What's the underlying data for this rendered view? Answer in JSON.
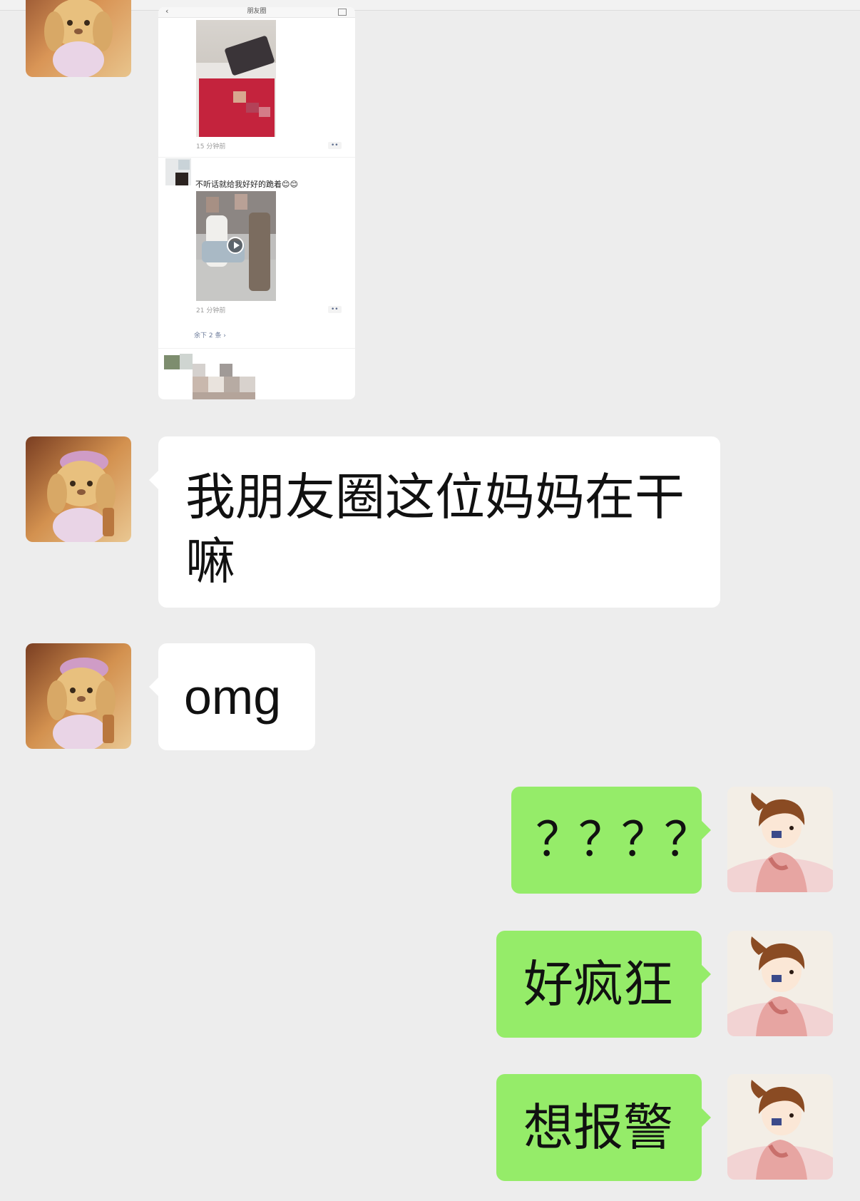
{
  "screenshot_card": {
    "header_title": "朋友圈",
    "back_glyph": "‹",
    "post1_time": "15 分钟前",
    "post2_caption": "不听话就给我好好的跪着😊😊",
    "post2_time": "21 分钟前",
    "more_link": "余下 2 条 ›",
    "dots": "••"
  },
  "messages": [
    {
      "side": "in",
      "text": "我朋友圈这位妈妈在干嘛"
    },
    {
      "side": "in",
      "text": "omg"
    },
    {
      "side": "out",
      "text": "？？？？"
    },
    {
      "side": "out",
      "text": "好疯狂"
    },
    {
      "side": "out",
      "text": "想报警"
    }
  ],
  "colors": {
    "background": "#ededed",
    "incoming_bubble": "#ffffff",
    "outgoing_bubble": "#95ec69"
  },
  "icons": {
    "friend_avatar": "plush-bunny-avatar",
    "self_avatar": "anime-girl-avatar",
    "play": "play-icon"
  }
}
